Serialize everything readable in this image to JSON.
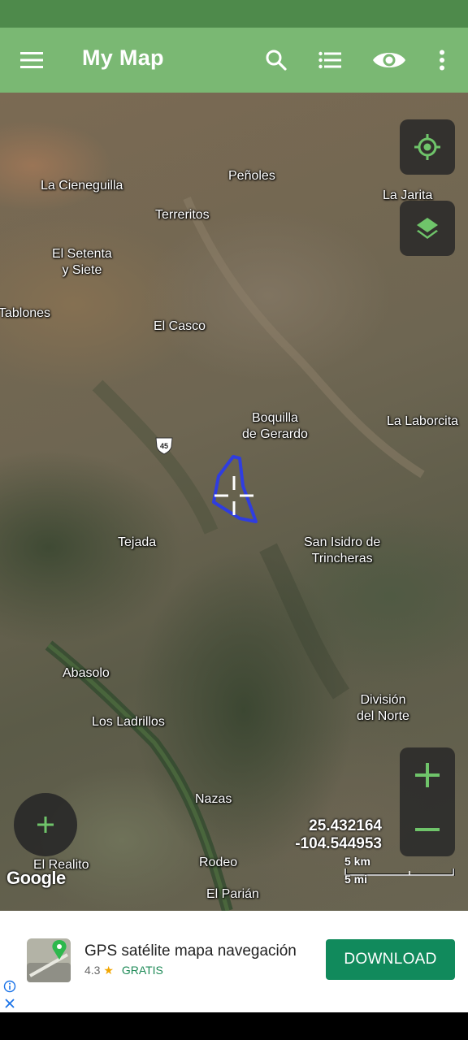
{
  "app_bar": {
    "title": "My Map",
    "icons": [
      "menu-icon",
      "search-icon",
      "list-icon",
      "eye-icon",
      "more-vert-icon"
    ]
  },
  "map": {
    "place_labels": [
      {
        "id": "la-cieneguilla",
        "text": "La Cieneguilla"
      },
      {
        "id": "penoles",
        "text": "Peñoles"
      },
      {
        "id": "la-jarita",
        "text": "La Jarita"
      },
      {
        "id": "terreritos",
        "text": "Terreritos"
      },
      {
        "id": "el-setenta",
        "text": "El Setenta\ny Siete"
      },
      {
        "id": "tablones",
        "text": "Tablones"
      },
      {
        "id": "el-casco",
        "text": "El Casco"
      },
      {
        "id": "boquilla",
        "text": "Boquilla\nde Gerardo"
      },
      {
        "id": "la-laborcita",
        "text": "La Laborcita"
      },
      {
        "id": "tejada",
        "text": "Tejada"
      },
      {
        "id": "san-isidro",
        "text": "San Isidro de\nTrincheras"
      },
      {
        "id": "abasolo",
        "text": "Abasolo"
      },
      {
        "id": "division",
        "text": "División\ndel Norte"
      },
      {
        "id": "los-ladrillos",
        "text": "Los Ladrillos"
      },
      {
        "id": "nazas",
        "text": "Nazas"
      },
      {
        "id": "el-realito",
        "text": "El Realito"
      },
      {
        "id": "rodeo",
        "text": "Rodeo"
      },
      {
        "id": "el-parian",
        "text": "El Parián"
      }
    ],
    "highway_shield": "45",
    "coordinates": {
      "lat": "25.432164",
      "lon": "-104.544953"
    },
    "scale": {
      "km": "5 km",
      "mi": "5 mi"
    },
    "attribution": "Google",
    "colors": {
      "polygon": "#2f3de0",
      "app_green": "#7ab873",
      "status_green": "#4e8a4b"
    }
  },
  "ad": {
    "title": "GPS satélite mapa navegación",
    "rating": "4.3",
    "price": "GRATIS",
    "button_label": "DOWNLOAD",
    "button_color": "#118a5c"
  }
}
